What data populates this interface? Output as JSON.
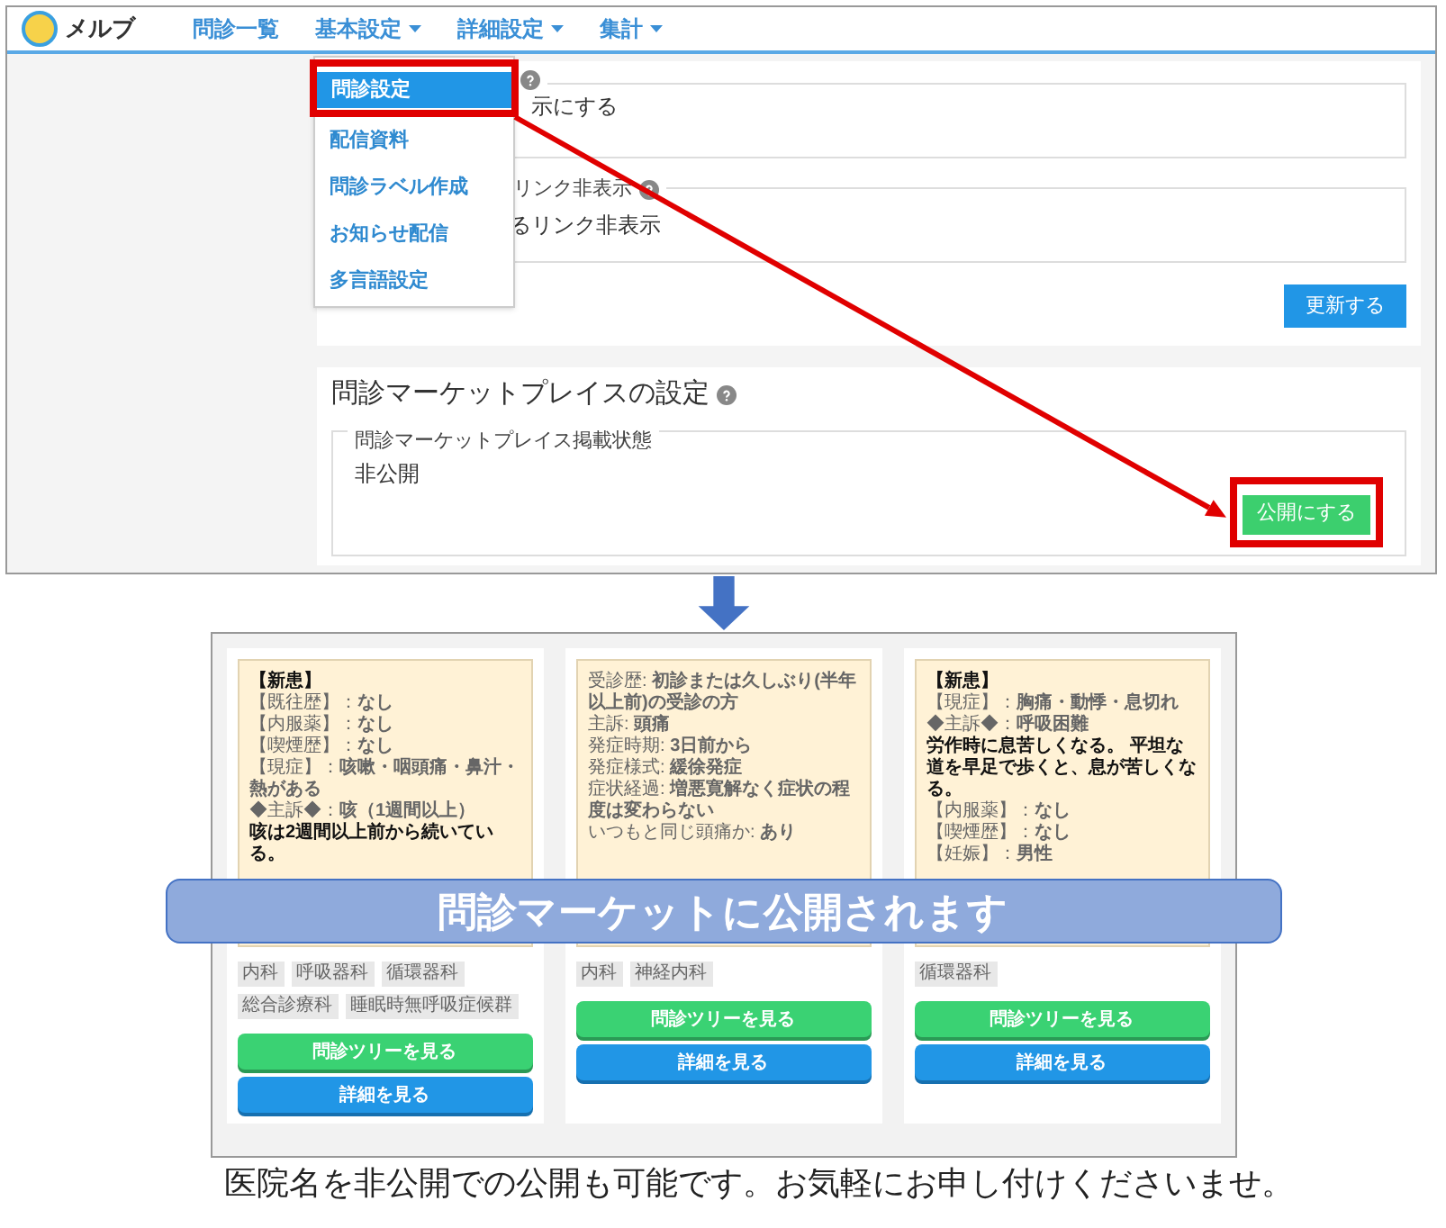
{
  "nav": {
    "brand": "メルブ",
    "items": [
      {
        "label": "問診一覧",
        "dropdown": false
      },
      {
        "label": "基本設定",
        "dropdown": true
      },
      {
        "label": "詳細設定",
        "dropdown": true
      },
      {
        "label": "集計",
        "dropdown": true
      }
    ]
  },
  "dropdown_menu": [
    {
      "label": "問診設定",
      "selected": true,
      "annotated": true
    },
    {
      "label": "配信資料",
      "selected": false,
      "annotated": false
    },
    {
      "label": "問診ラベル作成",
      "selected": false,
      "annotated": false
    },
    {
      "label": "お知らせ配信",
      "selected": false,
      "annotated": false
    },
    {
      "label": "多言語設定",
      "selected": false,
      "annotated": false
    }
  ],
  "settings_panel": {
    "fields": [
      {
        "help": true,
        "text": "示にする"
      },
      {
        "legend": "リンク非表示",
        "help": true,
        "text": "るリンク非表示"
      }
    ],
    "update_button": "更新する"
  },
  "marketplace": {
    "title": "問診マーケットプレイスの設定",
    "help": true,
    "status_legend": "問診マーケットプレイス掲載状態",
    "status": "非公開",
    "publish_button": "公開にする",
    "annotated": true
  },
  "preview": {
    "cards": [
      {
        "notes": [
          {
            "text": "【新患】",
            "bold": true
          },
          {
            "text": "【既往歴】：**なし**",
            "bold": false
          },
          {
            "text": "【内服薬】：**なし**",
            "bold": false
          },
          {
            "text": "【喫煙歴】：**なし**",
            "bold": false
          },
          {
            "text": "【現症】：**咳嗽・咽頭痛・鼻汁・熱がある**",
            "bold": false
          },
          {
            "text": "◆主訴◆：**咳（1週間以上）**",
            "bold": false
          },
          {
            "text": "咳は2週間以上前から続いている。",
            "bold": true
          }
        ],
        "tags": [
          "内科",
          "呼吸器科",
          "循環器科",
          "総合診療科",
          "睡眠時無呼吸症候群"
        ],
        "tree_button": "問診ツリーを見る",
        "detail_button": "詳細を見る"
      },
      {
        "notes": [
          {
            "text": "受診歴: **初診または久しぶり(半年以上前)の受診の方**",
            "bold": false
          },
          {
            "text": "主訴: **頭痛**",
            "bold": false
          },
          {
            "text": "発症時期: **3日前から**",
            "bold": false
          },
          {
            "text": "発症様式: **緩徐発症**",
            "bold": false
          },
          {
            "text": "症状経過: **増悪寛解なく症状の程度は変わらない**",
            "bold": false
          },
          {
            "text": "いつもと同じ頭痛か: **あり**",
            "bold": false
          }
        ],
        "tags": [
          "内科",
          "神経内科"
        ],
        "tree_button": "問診ツリーを見る",
        "detail_button": "詳細を見る"
      },
      {
        "notes": [
          {
            "text": "【新患】",
            "bold": true
          },
          {
            "text": "【現症】：**胸痛・動悸・息切れ**",
            "bold": false
          },
          {
            "text": "◆主訴◆：**呼吸困難**",
            "bold": false
          },
          {
            "text": "労作時に息苦しくなる。 平坦な道を早足で歩くと、息が苦しくなる。",
            "bold": true
          },
          {
            "text": "【内服薬】：**なし**",
            "bold": false
          },
          {
            "text": "【喫煙歴】：**なし**",
            "bold": false
          },
          {
            "text": "【妊娠】：**男性**",
            "bold": false
          }
        ],
        "tags": [
          "循環器科"
        ],
        "tree_button": "問診ツリーを見る",
        "detail_button": "詳細を見る"
      }
    ],
    "banner": "問診マーケットに公開されます"
  },
  "caption": "医院名を非公開での公開も可能です。お気軽にお申し付けくださいませ。"
}
